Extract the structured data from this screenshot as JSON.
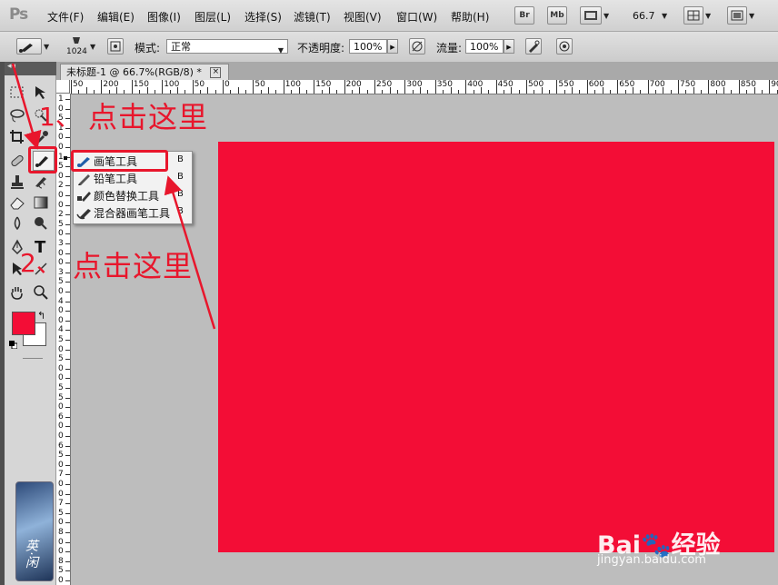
{
  "app": {
    "logo_text": "Ps"
  },
  "menubar": {
    "items": [
      "文件(F)",
      "编辑(E)",
      "图像(I)",
      "图层(L)",
      "选择(S)",
      "滤镜(T)",
      "视图(V)",
      "窗口(W)",
      "帮助(H)"
    ],
    "bridge_label": "Br",
    "minibridge_label": "Mb",
    "zoom_value": "66.7"
  },
  "options_bar": {
    "brush_size": "1024",
    "mode_label": "模式:",
    "mode_value": "正常",
    "opacity_label": "不透明度:",
    "opacity_value": "100%",
    "flow_label": "流量:",
    "flow_value": "100%"
  },
  "document": {
    "tab_title": "未标题-1 @ 66.7%(RGB/8) *",
    "close_glyph": "×",
    "canvas_color": "#f30d36"
  },
  "rulers": {
    "horizontal": [
      "50",
      "200",
      "150",
      "100",
      "50",
      "0",
      "50",
      "100",
      "150",
      "200",
      "250",
      "300",
      "350",
      "400",
      "450",
      "500",
      "550",
      "600",
      "650",
      "700",
      "750",
      "800",
      "850",
      "900"
    ],
    "vertical": [
      "1",
      "0",
      "5",
      "1",
      "0",
      "0",
      "1",
      "5",
      "0",
      "2",
      "0",
      "0",
      "2",
      "5",
      "0",
      "3",
      "0",
      "0",
      "3",
      "5",
      "0",
      "4",
      "0",
      "0",
      "4",
      "5",
      "0",
      "5",
      "0",
      "0",
      "5",
      "5",
      "0",
      "6",
      "0",
      "0",
      "6",
      "5",
      "0",
      "7",
      "0",
      "0",
      "7",
      "5",
      "0",
      "8",
      "0",
      "0",
      "8",
      "5",
      "0"
    ]
  },
  "tool_flyout": {
    "items": [
      {
        "label": "画笔工具",
        "key": "B"
      },
      {
        "label": "铅笔工具",
        "key": "B"
      },
      {
        "label": "颜色替换工具",
        "key": "B"
      },
      {
        "label": "混合器画笔工具",
        "key": "B"
      }
    ]
  },
  "colors": {
    "foreground": "#f30d36",
    "background": "#ffffff",
    "annotation": "#e8162c"
  },
  "annotations": {
    "step1_number": "1、",
    "step1_text": "点击这里",
    "step2_number": "2、",
    "step2_text": "点击这里"
  },
  "watermark": {
    "logo_text": "Bai🐾经验",
    "url": "jingyan.baidu.com"
  },
  "avatar": {
    "text": "英·闲"
  }
}
